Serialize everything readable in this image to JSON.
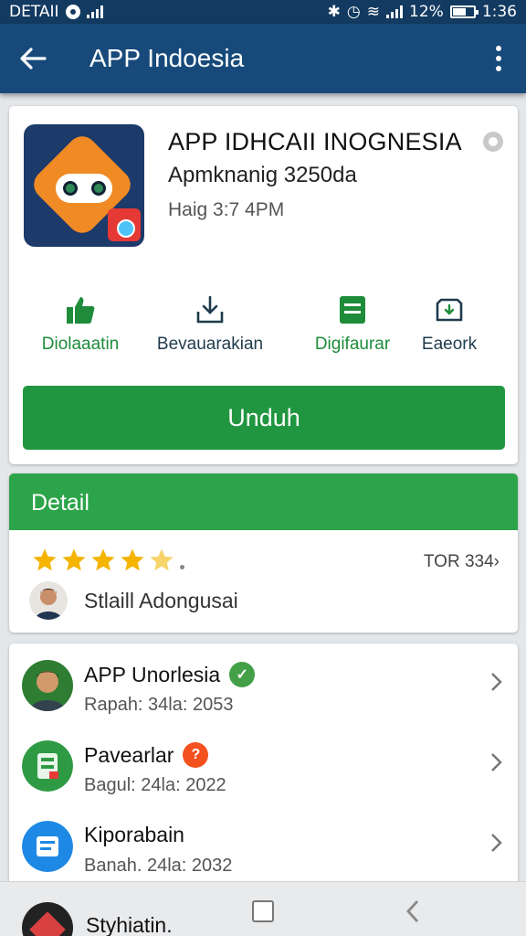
{
  "status_bar": {
    "left_text": "DETAII",
    "time": "1:36",
    "battery": "12%"
  },
  "app_bar": {
    "title": "APP Indoesia"
  },
  "app": {
    "name": "APP IDHCAII INOGNESIA",
    "developer": "Apmknanig 3250da",
    "time": "Haig 3:7 4PM"
  },
  "actions": [
    {
      "label": "Diolaaatin",
      "icon": "thumbs-up-icon",
      "color": "#1e8c3a"
    },
    {
      "label": "Bevauarakian",
      "icon": "download-icon",
      "color": "#1f3b4d"
    },
    {
      "label": "Digifaurar",
      "icon": "document-icon",
      "color": "#1e8c3a"
    },
    {
      "label": "Eaeork",
      "icon": "badge-icon",
      "color": "#1f3b4d"
    }
  ],
  "primary_button": {
    "label": "Unduh"
  },
  "detail": {
    "header": "Detail",
    "rating": 4.5,
    "rating_count": "TOR 334",
    "reviewer": "Stlaill Adongusai"
  },
  "list": [
    {
      "title": "APP Unorlesia",
      "subtitle": "Rapah: 34la: 2053",
      "badge_color": "#43a047",
      "badge_icon": "check-icon"
    },
    {
      "title": "Pavearlar",
      "subtitle": "Bagul: 24la: 2022",
      "badge_color": "#f4511e",
      "badge_icon": "alert-icon"
    },
    {
      "title": "Kiporabain",
      "subtitle": "Banah. 24la: 2032"
    }
  ],
  "bottom": {
    "partial_item_title": "Styhiatin."
  },
  "colors": {
    "primary_blue": "#174a7a",
    "primary_green": "#219641",
    "detail_green": "#2ca44a"
  }
}
